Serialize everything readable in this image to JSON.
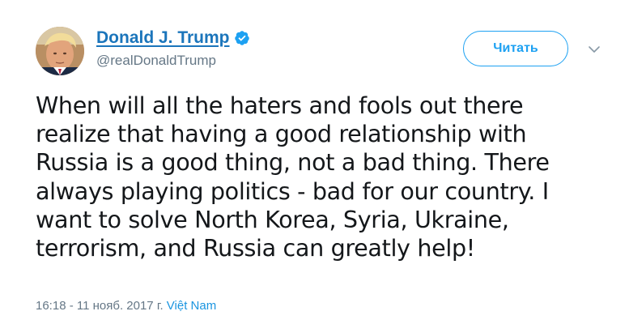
{
  "user": {
    "display_name": "Donald J. Trump",
    "handle": "@realDonaldTrump",
    "verified": true
  },
  "follow_button": {
    "label": "Читать"
  },
  "tweet": {
    "text": "When will all the haters and fools out there\nrealize that having a good relationship with\nRussia is a good thing, not a bad thing. There\nalways playing politics - bad for our country. I\nwant to solve North Korea, Syria, Ukraine,\nterrorism, and Russia can greatly help!",
    "timestamp": "16:18 - 11 нояб. 2017 г.",
    "location": "Việt Nam"
  },
  "icons": {
    "verified": "verified-badge-icon",
    "caret": "chevron-down-icon"
  },
  "colors": {
    "name": "#1b75bb",
    "accent": "#1da1f2",
    "muted": "#657786",
    "text": "#14171a"
  }
}
